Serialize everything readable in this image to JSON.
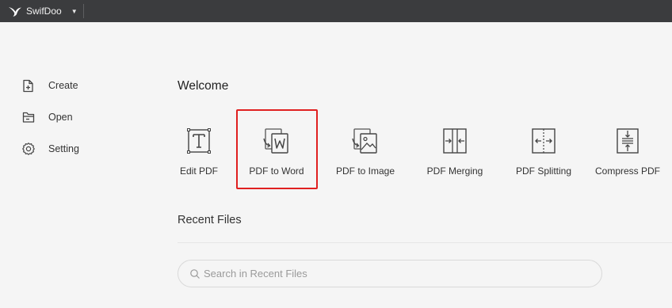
{
  "titlebar": {
    "app_name": "SwifDoo",
    "logo_icon": "swift-bird-logo-icon",
    "dropdown_icon": "caret-down-icon"
  },
  "sidebar": {
    "items": [
      {
        "label": "Create",
        "icon": "file-plus-icon"
      },
      {
        "label": "Open",
        "icon": "folder-open-icon"
      },
      {
        "label": "Setting",
        "icon": "gear-icon"
      }
    ]
  },
  "main": {
    "welcome_title": "Welcome",
    "tools": [
      {
        "label": "Edit PDF",
        "icon": "text-edit-icon"
      },
      {
        "label": "PDF to Word",
        "icon": "pdf-to-word-icon",
        "highlighted": true
      },
      {
        "label": "PDF to Image",
        "icon": "pdf-to-image-icon"
      },
      {
        "label": "PDF Merging",
        "icon": "merge-icon"
      },
      {
        "label": "PDF Splitting",
        "icon": "split-icon"
      },
      {
        "label": "Compress PDF",
        "icon": "compress-icon"
      }
    ],
    "highlight_color": "#e02020",
    "recent": {
      "title": "Recent Files",
      "search_placeholder": "Search in Recent Files"
    }
  },
  "colors": {
    "titlebar_bg": "#3b3c3e",
    "page_bg": "#f5f5f5"
  }
}
